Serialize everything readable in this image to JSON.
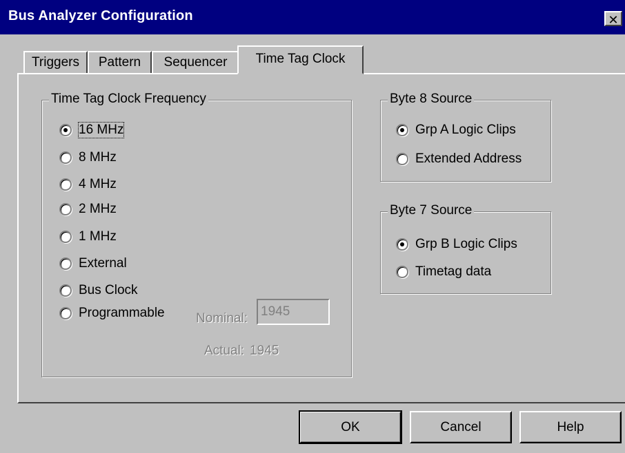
{
  "window": {
    "title": "Bus Analyzer Configuration",
    "close_glyph": "✕"
  },
  "tabs": [
    {
      "label": "Triggers",
      "active": false
    },
    {
      "label": "Pattern",
      "active": false
    },
    {
      "label": "Sequencer",
      "active": false
    },
    {
      "label": "Time Tag Clock",
      "active": true
    }
  ],
  "frequency_group": {
    "legend": "Time Tag Clock Frequency",
    "options": [
      {
        "label": "16 MHz",
        "selected": true
      },
      {
        "label": "8 MHz",
        "selected": false
      },
      {
        "label": "4 MHz",
        "selected": false
      },
      {
        "label": "2 MHz",
        "selected": false
      },
      {
        "label": "1 MHz",
        "selected": false
      },
      {
        "label": "External",
        "selected": false
      },
      {
        "label": "Bus Clock",
        "selected": false
      },
      {
        "label": "Programmable",
        "selected": false
      }
    ],
    "nominal_label": "Nominal:",
    "nominal_value": "1945",
    "actual_label": "Actual:",
    "actual_value": "1945"
  },
  "byte8_group": {
    "legend": "Byte 8 Source",
    "options": [
      {
        "label": "Grp A Logic Clips",
        "selected": true
      },
      {
        "label": "Extended Address",
        "selected": false
      }
    ]
  },
  "byte7_group": {
    "legend": "Byte 7 Source",
    "options": [
      {
        "label": "Grp B Logic Clips",
        "selected": true
      },
      {
        "label": "Timetag data",
        "selected": false
      }
    ]
  },
  "buttons": {
    "ok": "OK",
    "cancel": "Cancel",
    "help": "Help"
  }
}
